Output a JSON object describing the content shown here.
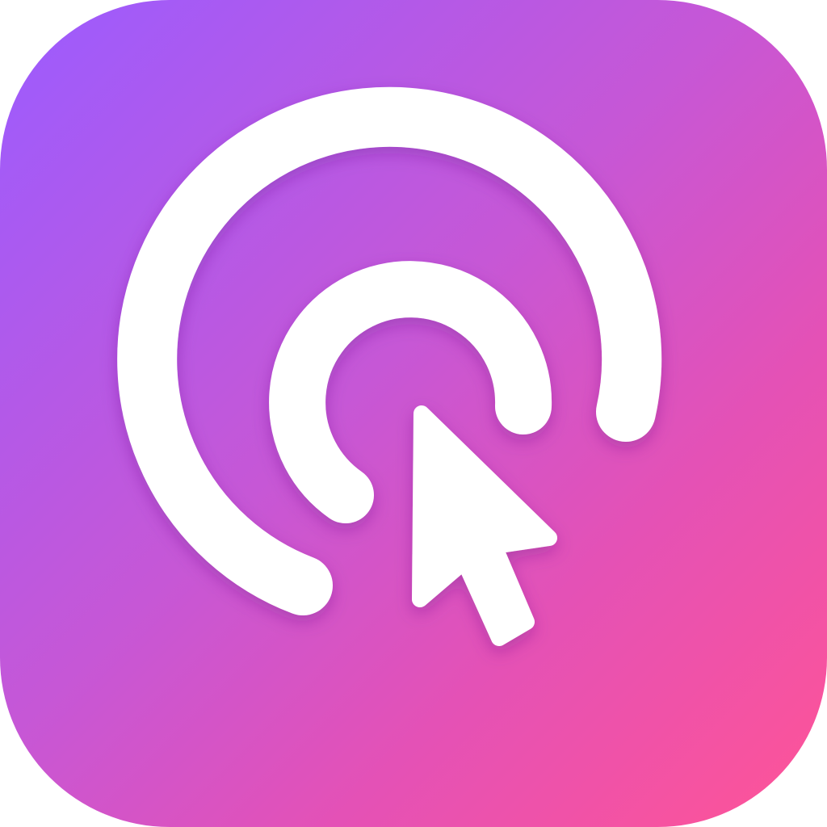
{
  "app_icon": {
    "icon": "click-tap-icon",
    "colors": {
      "gradient_start": "#9b5cff",
      "gradient_mid": "#c657d6",
      "gradient_mid2": "#e451b6",
      "gradient_end": "#ff5496",
      "glyph": "#ffffff"
    },
    "parts": {
      "outer_ring": "click-ripple-outer-icon",
      "inner_ring": "click-ripple-inner-icon",
      "pointer": "cursor-arrow-icon"
    }
  }
}
